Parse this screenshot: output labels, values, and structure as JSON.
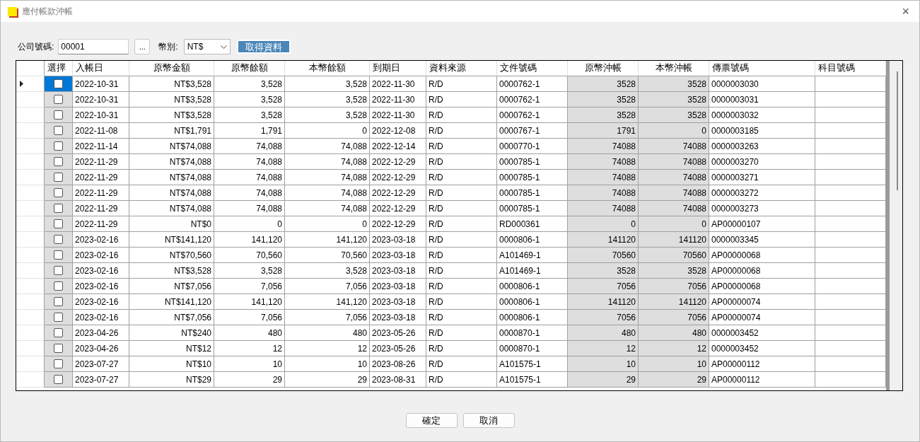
{
  "window": {
    "title": "應付帳款沖帳",
    "close": "×"
  },
  "filter": {
    "company_label": "公司號碼:",
    "company_value": "00001",
    "browse_button": "...",
    "currency_label": "幣別:",
    "currency_value": "NT$",
    "fetch_button": "取得資料"
  },
  "table": {
    "columns": [
      {
        "label": "選擇",
        "kind": "check"
      },
      {
        "label": "入帳日",
        "kind": "text"
      },
      {
        "label": "原幣金額",
        "kind": "amount"
      },
      {
        "label": "原幣餘額",
        "kind": "amount"
      },
      {
        "label": "本幣餘額",
        "kind": "amount"
      },
      {
        "label": "到期日",
        "kind": "text"
      },
      {
        "label": "資料來源",
        "kind": "text"
      },
      {
        "label": "文件號碼",
        "kind": "text"
      },
      {
        "label": "原幣沖帳",
        "kind": "settle"
      },
      {
        "label": "本幣沖帳",
        "kind": "settle"
      },
      {
        "label": "傳票號碼",
        "kind": "text"
      },
      {
        "label": "科目號碼",
        "kind": "text"
      }
    ],
    "rows": [
      {
        "selected": true,
        "checked": false,
        "cells": [
          "",
          "2022-10-31",
          "NT$3,528",
          "3,528",
          "3,528",
          "2022-11-30",
          "R/D",
          "0000762-1",
          "3528",
          "3528",
          "0000003030",
          ""
        ]
      },
      {
        "selected": false,
        "checked": false,
        "cells": [
          "",
          "2022-10-31",
          "NT$3,528",
          "3,528",
          "3,528",
          "2022-11-30",
          "R/D",
          "0000762-1",
          "3528",
          "3528",
          "0000003031",
          ""
        ]
      },
      {
        "selected": false,
        "checked": false,
        "cells": [
          "",
          "2022-10-31",
          "NT$3,528",
          "3,528",
          "3,528",
          "2022-11-30",
          "R/D",
          "0000762-1",
          "3528",
          "3528",
          "0000003032",
          ""
        ]
      },
      {
        "selected": false,
        "checked": false,
        "cells": [
          "",
          "2022-11-08",
          "NT$1,791",
          "1,791",
          "0",
          "2022-12-08",
          "R/D",
          "0000767-1",
          "1791",
          "0",
          "0000003185",
          ""
        ]
      },
      {
        "selected": false,
        "checked": false,
        "cells": [
          "",
          "2022-11-14",
          "NT$74,088",
          "74,088",
          "74,088",
          "2022-12-14",
          "R/D",
          "0000770-1",
          "74088",
          "74088",
          "0000003263",
          ""
        ]
      },
      {
        "selected": false,
        "checked": false,
        "cells": [
          "",
          "2022-11-29",
          "NT$74,088",
          "74,088",
          "74,088",
          "2022-12-29",
          "R/D",
          "0000785-1",
          "74088",
          "74088",
          "0000003270",
          ""
        ]
      },
      {
        "selected": false,
        "checked": false,
        "cells": [
          "",
          "2022-11-29",
          "NT$74,088",
          "74,088",
          "74,088",
          "2022-12-29",
          "R/D",
          "0000785-1",
          "74088",
          "74088",
          "0000003271",
          ""
        ]
      },
      {
        "selected": false,
        "checked": false,
        "cells": [
          "",
          "2022-11-29",
          "NT$74,088",
          "74,088",
          "74,088",
          "2022-12-29",
          "R/D",
          "0000785-1",
          "74088",
          "74088",
          "0000003272",
          ""
        ]
      },
      {
        "selected": false,
        "checked": false,
        "cells": [
          "",
          "2022-11-29",
          "NT$74,088",
          "74,088",
          "74,088",
          "2022-12-29",
          "R/D",
          "0000785-1",
          "74088",
          "74088",
          "0000003273",
          ""
        ]
      },
      {
        "selected": false,
        "checked": false,
        "cells": [
          "",
          "2022-11-29",
          "NT$0",
          "0",
          "0",
          "2022-12-29",
          "R/D",
          "RD000361",
          "0",
          "0",
          "AP00000107",
          ""
        ]
      },
      {
        "selected": false,
        "checked": false,
        "cells": [
          "",
          "2023-02-16",
          "NT$141,120",
          "141,120",
          "141,120",
          "2023-03-18",
          "R/D",
          "0000806-1",
          "141120",
          "141120",
          "0000003345",
          ""
        ]
      },
      {
        "selected": false,
        "checked": false,
        "cells": [
          "",
          "2023-02-16",
          "NT$70,560",
          "70,560",
          "70,560",
          "2023-03-18",
          "R/D",
          "A101469-1",
          "70560",
          "70560",
          "AP00000068",
          ""
        ]
      },
      {
        "selected": false,
        "checked": false,
        "cells": [
          "",
          "2023-02-16",
          "NT$3,528",
          "3,528",
          "3,528",
          "2023-03-18",
          "R/D",
          "A101469-1",
          "3528",
          "3528",
          "AP00000068",
          ""
        ]
      },
      {
        "selected": false,
        "checked": false,
        "cells": [
          "",
          "2023-02-16",
          "NT$7,056",
          "7,056",
          "7,056",
          "2023-03-18",
          "R/D",
          "0000806-1",
          "7056",
          "7056",
          "AP00000068",
          ""
        ]
      },
      {
        "selected": false,
        "checked": false,
        "cells": [
          "",
          "2023-02-16",
          "NT$141,120",
          "141,120",
          "141,120",
          "2023-03-18",
          "R/D",
          "0000806-1",
          "141120",
          "141120",
          "AP00000074",
          ""
        ]
      },
      {
        "selected": false,
        "checked": false,
        "cells": [
          "",
          "2023-02-16",
          "NT$7,056",
          "7,056",
          "7,056",
          "2023-03-18",
          "R/D",
          "0000806-1",
          "7056",
          "7056",
          "AP00000074",
          ""
        ]
      },
      {
        "selected": false,
        "checked": false,
        "cells": [
          "",
          "2023-04-26",
          "NT$240",
          "480",
          "480",
          "2023-05-26",
          "R/D",
          "0000870-1",
          "480",
          "480",
          "0000003452",
          ""
        ]
      },
      {
        "selected": false,
        "checked": false,
        "cells": [
          "",
          "2023-04-26",
          "NT$12",
          "12",
          "12",
          "2023-05-26",
          "R/D",
          "0000870-1",
          "12",
          "12",
          "0000003452",
          ""
        ]
      },
      {
        "selected": false,
        "checked": false,
        "cells": [
          "",
          "2023-07-27",
          "NT$10",
          "10",
          "10",
          "2023-08-26",
          "R/D",
          "A101575-1",
          "10",
          "10",
          "AP00000112",
          ""
        ]
      },
      {
        "selected": false,
        "checked": false,
        "cells": [
          "",
          "2023-07-27",
          "NT$29",
          "29",
          "29",
          "2023-08-31",
          "R/D",
          "A101575-1",
          "29",
          "29",
          "AP00000112",
          ""
        ]
      }
    ]
  },
  "buttons": [
    "確定",
    "取消"
  ]
}
